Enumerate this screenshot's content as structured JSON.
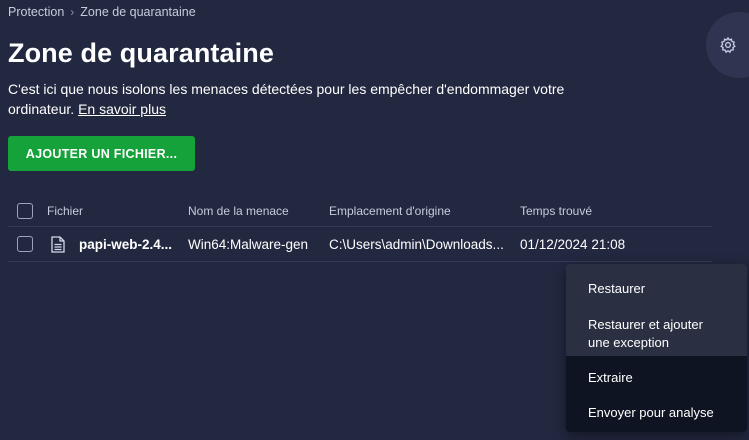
{
  "breadcrumb": {
    "parent": "Protection",
    "current": "Zone de quarantaine"
  },
  "page": {
    "title": "Zone de quarantaine",
    "description": "C'est ici que nous isolons les menaces détectées pour les empêcher d'endommager votre ordinateur.",
    "learn_more": "En savoir plus",
    "add_button": "AJOUTER UN FICHIER..."
  },
  "table": {
    "headers": {
      "file": "Fichier",
      "threat": "Nom de la menace",
      "location": "Emplacement d'origine",
      "time": "Temps trouvé"
    },
    "rows": [
      {
        "file": "papi-web-2.4...",
        "threat": "Win64:Malware-gen",
        "location": "C:\\Users\\admin\\Downloads...",
        "time": "01/12/2024 21:08"
      }
    ]
  },
  "context_menu": {
    "items": [
      {
        "label": "Restaurer",
        "hovered": true
      },
      {
        "label_line1": "Restaurer et ajouter",
        "label_line2": "une exception",
        "hovered": true
      },
      {
        "label": "Extraire",
        "hovered": false
      },
      {
        "label": "Envoyer pour analyse",
        "hovered": false
      }
    ]
  },
  "icons": {
    "settings": "gear-icon",
    "file": "document-icon",
    "separator": "chevron-right-icon"
  },
  "colors": {
    "background": "#222840",
    "accent_green": "#16a23a",
    "menu_background": "#0f1423"
  }
}
